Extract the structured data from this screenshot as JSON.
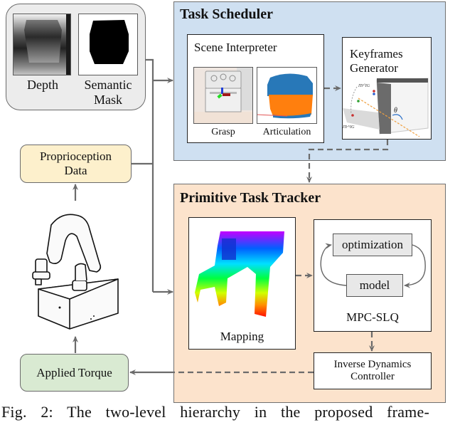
{
  "sensors": {
    "depth_label": "Depth",
    "mask_label_line1": "Semantic",
    "mask_label_line2": "Mask"
  },
  "task_scheduler": {
    "title": "Task Scheduler",
    "scene_interpreter": {
      "title": "Scene Interpreter",
      "grasp_label": "Grasp",
      "articulation_label": "Articulation"
    },
    "keyframes": {
      "title_line1": "Keyframes",
      "title_line2": "Generator",
      "theta_symbol": "θ",
      "pose_start": "ITr⁰IG",
      "pose_end": "ITrᴺIG"
    }
  },
  "primitive_task_tracker": {
    "title": "Primitive Task Tracker",
    "mapping_label": "Mapping",
    "mpc": {
      "optimization_label": "optimization",
      "model_label": "model",
      "title": "MPC-SLQ"
    },
    "inverse_dynamics": {
      "line1": "Inverse Dynamics",
      "line2": "Controller"
    }
  },
  "proprioception": {
    "line1": "Proprioception",
    "line2": "Data"
  },
  "applied_torque": {
    "label": "Applied Torque"
  },
  "caption": "Fig. 2: The two-level hierarchy in the proposed frame-",
  "colors": {
    "scheduler_bg": "#cfe0f1",
    "tracker_bg": "#fce3cc",
    "proprioception_bg": "#fdf0cc",
    "torque_bg": "#d9ead2",
    "sensor_bg": "#ececec",
    "arrow": "#6b6b6b"
  }
}
